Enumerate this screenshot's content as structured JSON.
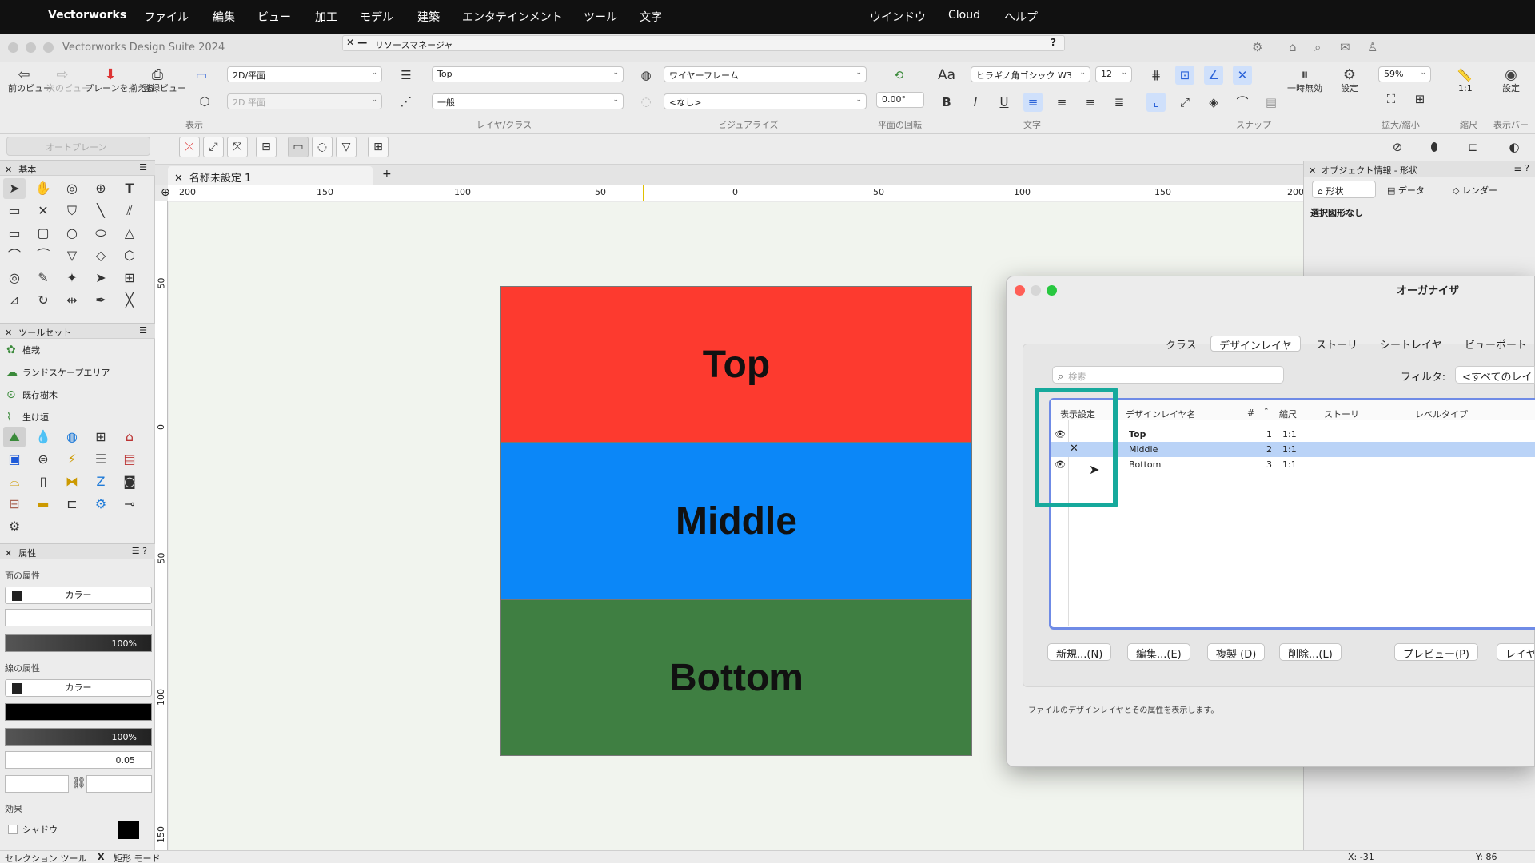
{
  "menubar": {
    "app": "Vectorworks",
    "items": [
      "ファイル",
      "編集",
      "ビュー",
      "加工",
      "モデル",
      "建築",
      "エンタテインメント",
      "ツール",
      "文字"
    ],
    "right_items": [
      "ウインドウ",
      "Cloud",
      "ヘルプ"
    ]
  },
  "window": {
    "title": "Vectorworks Design Suite 2024",
    "resource_manager": "リソースマネージャ",
    "help": "?"
  },
  "toolbar": {
    "prev_view": "前のビュー",
    "next_view": "次のビュー",
    "align_plane": "プレーンを揃える",
    "saved_view": "登録ビュー",
    "view_select": "2D/平面",
    "view_select2": "2D 平面",
    "group_view": "表示",
    "layer": "Top",
    "class": "一般",
    "group_layer": "レイヤ/クラス",
    "render": "ワイヤーフレーム",
    "light": "<なし>",
    "group_visualize": "ビジュアライズ",
    "rotation": "0.00°",
    "group_rotation": "平面の回転",
    "font": "ヒラギノ角ゴシック W3",
    "font_size": "12",
    "group_text": "文字",
    "group_snap": "スナップ",
    "pause": "一時無効",
    "settings": "設定",
    "zoom": "59%",
    "group_zoom": "拡大/縮小",
    "scale": "1:1",
    "group_scale": "縮尺",
    "display_bar": "設定",
    "group_display": "表示バー"
  },
  "modebar": {
    "auto_plane": "オートプレーン"
  },
  "left": {
    "basic_title": "基本",
    "toolsets_title": "ツールセット",
    "toolsets": [
      "植栽",
      "ランドスケープエリア",
      "既存樹木",
      "生け垣"
    ],
    "attr_title": "属性",
    "fill_label": "面の属性",
    "fill_type": "カラー",
    "fill_opacity": "100%",
    "line_label": "線の属性",
    "line_type": "カラー",
    "line_opacity": "100%",
    "line_weight": "0.05",
    "effects_label": "効果",
    "shadow": "シャドウ"
  },
  "doc": {
    "tab": "名称未設定 1",
    "add": "+"
  },
  "ruler": {
    "h_ticks": [
      "200",
      "150",
      "100",
      "50",
      "0",
      "50",
      "100",
      "150",
      "200"
    ],
    "v_ticks": [
      "50",
      "0",
      "50",
      "100",
      "150"
    ]
  },
  "canvas": {
    "rects": [
      {
        "label": "Top",
        "color": "#fd3a2f"
      },
      {
        "label": "Middle",
        "color": "#0b87f8"
      },
      {
        "label": "Bottom",
        "color": "#3f7f42"
      }
    ]
  },
  "objinfo": {
    "title": "オブジェクト情報 - 形状",
    "tabs": [
      "形状",
      "データ",
      "レンダー"
    ],
    "status": "選択図形なし"
  },
  "organizer": {
    "title": "オーガナイザ",
    "tabs": [
      "クラス",
      "デザインレイヤ",
      "ストーリ",
      "シートレイヤ",
      "ビューポート"
    ],
    "search_placeholder": "検索",
    "filter_label": "フィルタ:",
    "filter_value": "<すべてのレイ",
    "columns": {
      "visibility": "表示設定",
      "name": "デザインレイヤ名",
      "num": "#",
      "scale": "縮尺",
      "story": "ストーリ",
      "level": "レベルタイプ"
    },
    "rows": [
      {
        "name": "Top",
        "num": "1",
        "scale": "1:1"
      },
      {
        "name": "Middle",
        "num": "2",
        "scale": "1:1"
      },
      {
        "name": "Bottom",
        "num": "3",
        "scale": "1:1"
      }
    ],
    "buttons": [
      "新規...(N)",
      "編集...(E)",
      "複製 (D)",
      "削除...(L)",
      "プレビュー(P)",
      "レイヤ"
    ],
    "footer": "ファイルのデザインレイヤとその属性を表示します。"
  },
  "status": {
    "left": "セレクション ツール",
    "x_mark": "X",
    "mode": "矩形 モード",
    "x": "X: -31",
    "y": "Y: 86"
  }
}
